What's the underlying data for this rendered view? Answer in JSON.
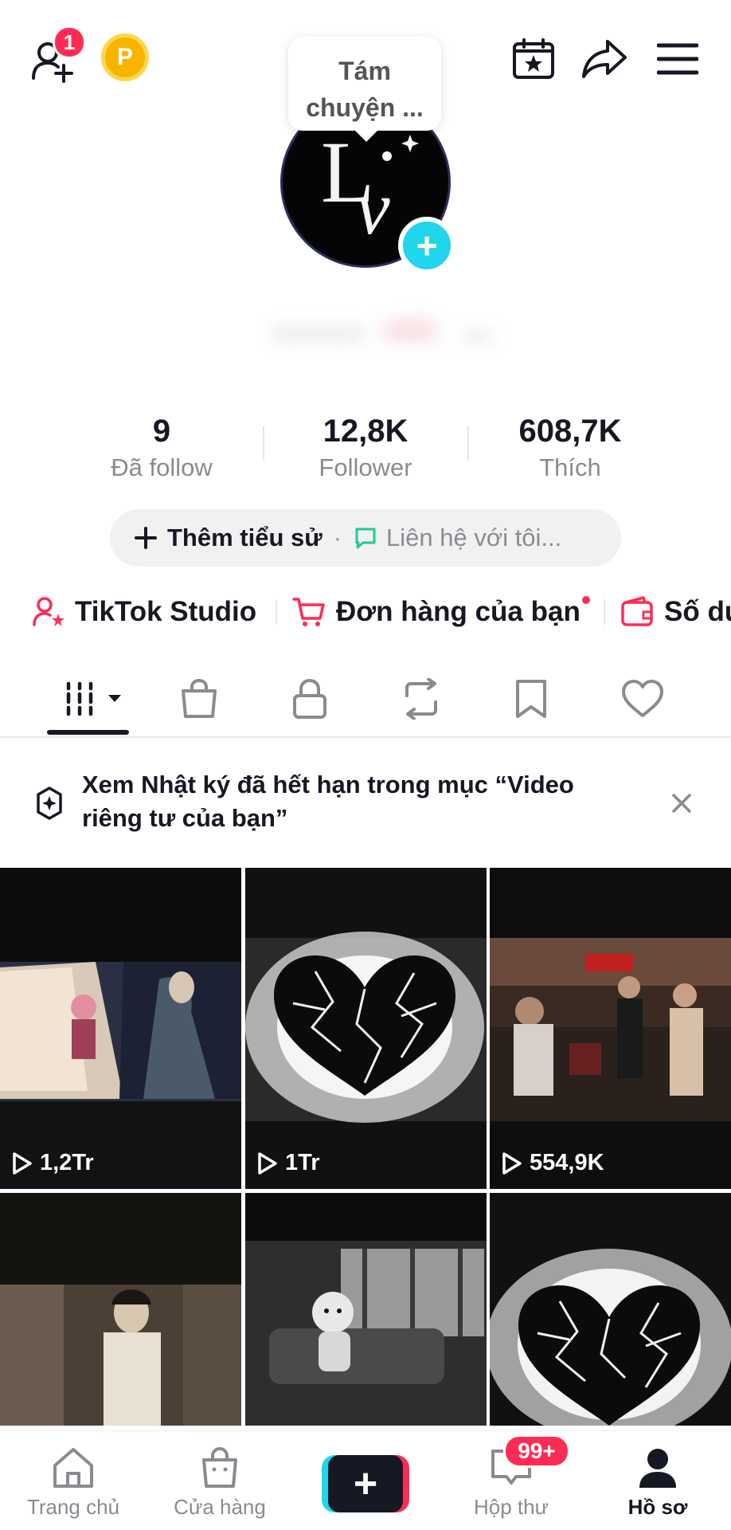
{
  "header": {
    "friend_badge": "1",
    "coin_label": "P",
    "bubble_text_line1": "Tám",
    "bubble_text_line2": "chuyện ..."
  },
  "profile": {
    "avatar_text": "Lv"
  },
  "stats": [
    {
      "value": "9",
      "label": "Đã follow"
    },
    {
      "value": "12,8K",
      "label": "Follower"
    },
    {
      "value": "608,7K",
      "label": "Thích"
    }
  ],
  "bio": {
    "add_label": "Thêm tiểu sử",
    "separator": "·",
    "contact_label": "Liên hệ với tôi..."
  },
  "links": [
    {
      "label": "TikTok Studio"
    },
    {
      "label": "Đơn hàng của bạn"
    },
    {
      "label": "Số dư"
    }
  ],
  "notice": {
    "text": "Xem Nhật ký đã hết hạn trong mục “Video riêng tư của bạn”"
  },
  "videos": [
    {
      "views": "1,2Tr"
    },
    {
      "views": "1Tr"
    },
    {
      "views": "554,9K"
    },
    {
      "views": ""
    },
    {
      "views": ""
    },
    {
      "views": ""
    }
  ],
  "bottom_nav": {
    "home": "Trang chủ",
    "shop": "Cửa hàng",
    "create": "+",
    "inbox": "Hộp thư",
    "inbox_badge": "99+",
    "profile": "Hồ sơ"
  },
  "colors": {
    "accent_red": "#fe2c55",
    "accent_cyan": "#20d5ec",
    "text_primary": "#161823",
    "text_secondary": "#8a8b91"
  }
}
